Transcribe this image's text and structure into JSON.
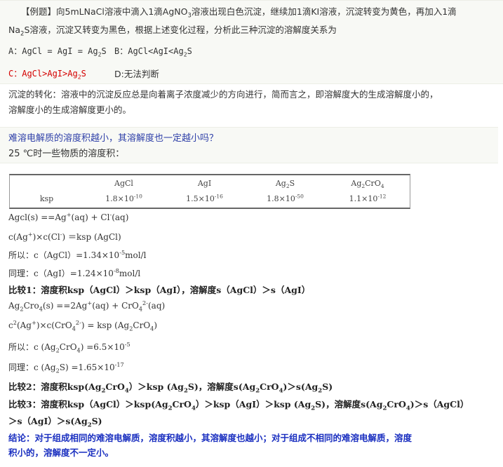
{
  "example": {
    "tag": "【例题】",
    "line1_a": "向5mLNaCl溶液中滴入1滴AgNO",
    "line1_sub": "3",
    "line1_b": "溶液出现白色沉淀，继续加1滴KI溶液，沉淀转变为黄色，再加入1滴",
    "line2_a": "Na",
    "line2_sub": "2",
    "line2_b": "S溶液，沉淀又转变为黑色，根据上述变化过程，分析此三种沉淀的溶解度关系为",
    "optA_a": "A：AgCl = AgI = Ag",
    "optA_sub": "2",
    "optA_b": "S",
    "optB_a": "B：AgCl<AgI<Ag",
    "optB_sub": "2",
    "optB_b": "S",
    "optC_a": "C：AgCl>AgI>Ag",
    "optC_sub": "2",
    "optC_b": "S",
    "optD": "D:无法判断"
  },
  "conversion": {
    "line1": "沉淀的转化：溶液中的沉淀反应总是向着离子浓度减少的方向进行，简而言之，即溶解度大的生成溶解度小的，",
    "line2": "溶解度小的生成溶解度更小的。"
  },
  "question": {
    "line1": "难溶电解质的溶度积越小，其溶解度也一定越小吗？",
    "line2": "25 ℃时一些物质的溶度积："
  },
  "table": {
    "row_label": "ksp",
    "h1": "AgCl",
    "h2": "AgI",
    "h3_a": "Ag",
    "h3_sub": "2",
    "h3_b": "S",
    "h4_a": "Ag",
    "h4_sub1": "2",
    "h4_b": "CrO",
    "h4_sub2": "4",
    "v1_a": "1.8×10",
    "v1_exp": "-10",
    "v2_a": "1.5×10",
    "v2_exp": "-16",
    "v3_a": "1.8×10",
    "v3_exp": "-50",
    "v4_a": "1.1×10",
    "v4_exp": "-12"
  },
  "lines": {
    "eq1_a": "Agcl(s) ==Ag",
    "eq1_sup1": "+",
    "eq1_b": "(aq) + Cl",
    "eq1_sup2": "-",
    "eq1_c": "(aq)",
    "eq2_a": "c(Ag",
    "eq2_sup1": "+",
    "eq2_b": ")×c(Cl",
    "eq2_sup2": "-",
    "eq2_c": ") ＝ksp (AgCl)",
    "so1_a": "所以：c（AgCl）=1.34×10",
    "so1_sup": "-5",
    "so1_b": "mol/l",
    "same1_a": "同理：c（AgI）=1.24×10",
    "same1_sup": "-8",
    "same1_b": "mol/l",
    "cmp1": "比较1：溶度积ksp（AgCl）＞ksp（AgI），溶解度s（AgCl）＞s（AgI）",
    "eq3_a": "Ag",
    "eq3_sub1": "2",
    "eq3_b": "Cro",
    "eq3_sub2": "4",
    "eq3_c": "(s) ==2Ag",
    "eq3_sup1": "+",
    "eq3_d": "(aq) + CrO",
    "eq3_sub3": "4",
    "eq3_sup2": "2-",
    "eq3_e": "(aq)",
    "eq4_a": "c",
    "eq4_sup1": "2",
    "eq4_b": "(Ag",
    "eq4_sup2": "+",
    "eq4_c": ")×c(CrO",
    "eq4_sub1": "4",
    "eq4_sup3": "2-",
    "eq4_d": ") = ksp (Ag",
    "eq4_sub2": "2",
    "eq4_e": "CrO",
    "eq4_sub3": "4",
    "eq4_f": ")",
    "so2_a": "所以：c (Ag",
    "so2_sub1": "2",
    "so2_b": "CrO",
    "so2_sub2": "4",
    "so2_c": ") =6.5×10",
    "so2_sup": "-5",
    "same2_a": "同理：c (Ag",
    "same2_sub": "2",
    "same2_b": "S) =1.65×10",
    "same2_sup": "-17",
    "cmp2_a": "比较2：溶度积ksp(Ag",
    "cmp2_s1": "2",
    "cmp2_b": "CrO",
    "cmp2_s2": "4",
    "cmp2_c": "）＞ksp (Ag",
    "cmp2_s3": "2",
    "cmp2_d": "S)，溶解度s(Ag",
    "cmp2_s4": "2",
    "cmp2_e": "CrO",
    "cmp2_s5": "4",
    "cmp2_f": ")＞s(Ag",
    "cmp2_s6": "2",
    "cmp2_g": "S)",
    "cmp3_a": "比较3：溶度积ksp（AgCl）＞ksp(Ag",
    "cmp3_s1": "2",
    "cmp3_b": "CrO",
    "cmp3_s2": "4",
    "cmp3_c": "）＞ksp（AgI）＞ksp (Ag",
    "cmp3_s3": "2",
    "cmp3_d": "S)，溶解度s(Ag",
    "cmp3_s4": "2",
    "cmp3_e": "CrO",
    "cmp3_s5": "4",
    "cmp3_f": ")＞s（AgCl）",
    "cmp3_line2_a": "＞s（AgI）＞s(Ag",
    "cmp3_line2_sub": "2",
    "cmp3_line2_b": "S)",
    "concl1": "结论：对于组成相同的难溶电解质，溶度积越小，其溶解度也越小；对于组成不相同的难溶电解质，溶度",
    "concl2": "积小的，溶解度不一定小。"
  }
}
